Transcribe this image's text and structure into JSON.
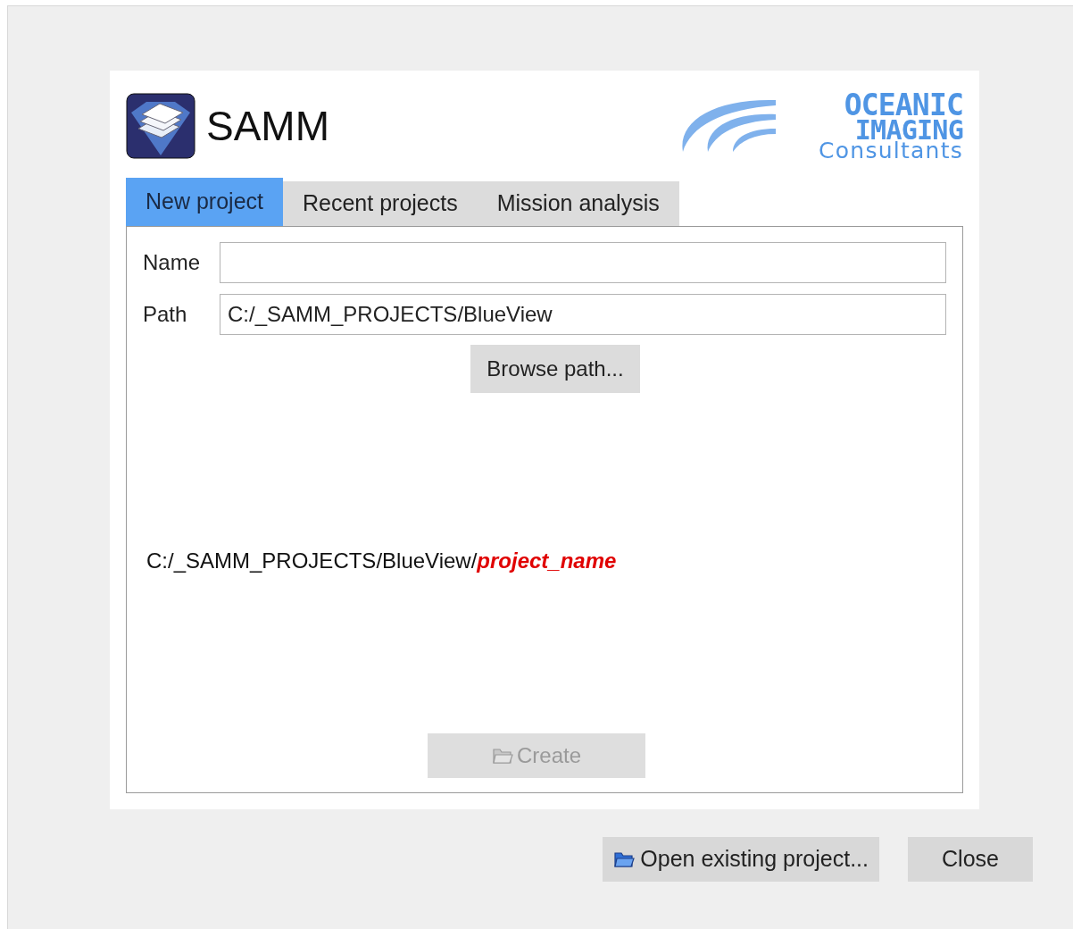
{
  "header": {
    "app_name": "SAMM",
    "logo_lines": [
      "OCEANIC",
      "IMAGING",
      "Consultants"
    ]
  },
  "tabs": [
    {
      "label": "New project",
      "selected": true
    },
    {
      "label": "Recent projects",
      "selected": false
    },
    {
      "label": "Mission analysis",
      "selected": false
    }
  ],
  "form": {
    "name_label": "Name",
    "path_label": "Path",
    "path_value": "C:/_SAMM_PROJECTS/BlueView",
    "browse_button": "Browse path...",
    "preview": "C:/_SAMM_PROJECTS/BlueView/**project_name**",
    "create_button": {
      "label": "Create",
      "disabled": true
    }
  },
  "buttons": [
    {
      "label": "Open existing project...",
      "kind": "open"
    },
    {
      "label": "Close",
      "kind": "close"
    }
  ]
}
